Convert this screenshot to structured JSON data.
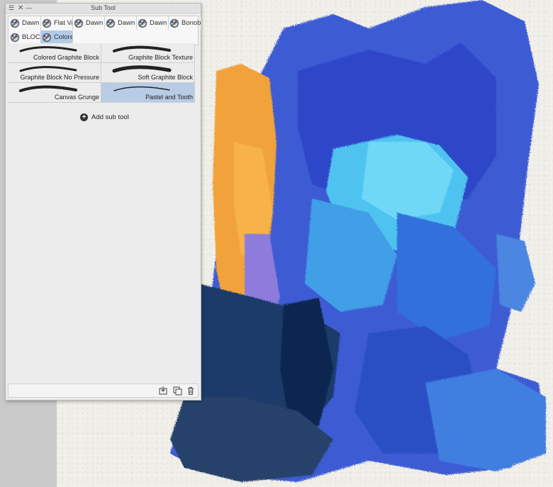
{
  "panel": {
    "title": "Sub Tool",
    "menu_icon": "hamburger-menu-icon",
    "close_icon": "close-icon",
    "minimize_icon": "minimize-icon"
  },
  "tabs": [
    {
      "label": "Dawn",
      "selected": false
    },
    {
      "label": "Flat Va",
      "selected": false
    },
    {
      "label": "Dawn",
      "selected": false
    },
    {
      "label": "Dawn",
      "selected": false
    },
    {
      "label": "Dawn",
      "selected": false
    },
    {
      "label": "Bonob",
      "selected": false
    },
    {
      "label": "BLOC",
      "selected": false
    },
    {
      "label": "Colore",
      "selected": true
    }
  ],
  "subtools": [
    {
      "label": "Colored Graphite Block",
      "selected": false
    },
    {
      "label": "Graphite Block Texture",
      "selected": false
    },
    {
      "label": "Graphite Block No Pressure",
      "selected": false
    },
    {
      "label": "Soft Graphite Block",
      "selected": false
    },
    {
      "label": "Canvas Grunge",
      "selected": false
    },
    {
      "label": "Pastel and Tooth",
      "selected": true
    }
  ],
  "add_sub_tool": {
    "label": "Add sub tool",
    "icon": "plus-circle-icon"
  },
  "bottom_icons": [
    "import-icon",
    "duplicate-icon",
    "trash-icon"
  ],
  "colors": {
    "selection": "#b8cde5",
    "panel_bg": "#ececec",
    "paper": "#f1efe9"
  }
}
